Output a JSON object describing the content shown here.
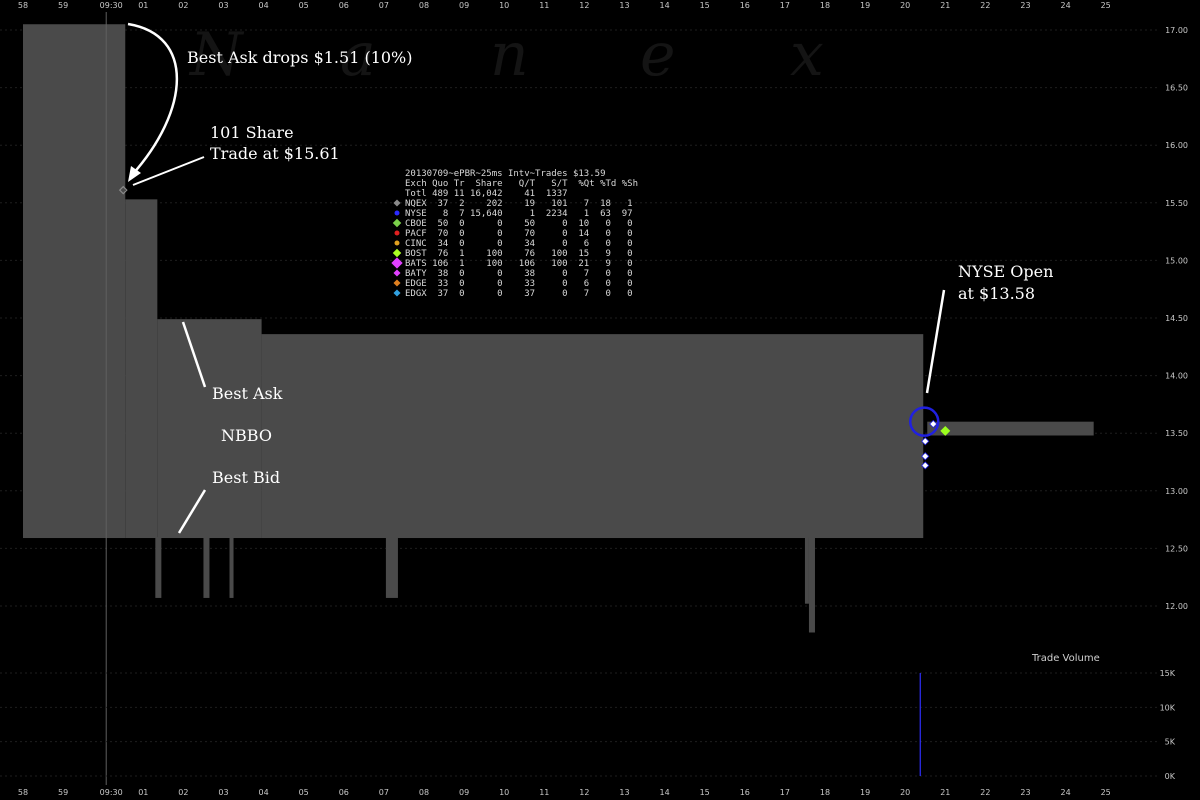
{
  "chart_data": {
    "type": "area",
    "title": "20130709~ePBR~25ms Intv~Trades $13.59",
    "watermark": [
      "N",
      "a",
      "n",
      "e",
      "x"
    ],
    "x_ticks": [
      "58",
      "59",
      "09:30",
      "01",
      "02",
      "03",
      "04",
      "05",
      "06",
      "07",
      "08",
      "09",
      "10",
      "11",
      "12",
      "13",
      "14",
      "15",
      "16",
      "17",
      "18",
      "19",
      "20",
      "21",
      "22",
      "23",
      "24",
      "25"
    ],
    "x_marker_label": "09:30",
    "y_ticks": [
      "17.00",
      "16.50",
      "16.00",
      "15.50",
      "15.00",
      "14.50",
      "14.00",
      "13.50",
      "13.00",
      "12.50",
      "12.00"
    ],
    "ylim": [
      11.7,
      17.25
    ],
    "nbbo_color": "#4a4a4a",
    "ask_steps": [
      {
        "t0": 0.0,
        "t1": 2.55,
        "ask": 17.05
      },
      {
        "t0": 2.55,
        "t1": 3.35,
        "ask": 15.53
      },
      {
        "t0": 3.35,
        "t1": 5.95,
        "ask": 14.49
      },
      {
        "t0": 5.95,
        "t1": 22.45,
        "ask": 14.36
      }
    ],
    "bid_level": 12.59,
    "bid_spikes": [
      {
        "t0": 3.3,
        "t1": 3.45,
        "bid": 12.07
      },
      {
        "t0": 4.5,
        "t1": 4.65,
        "bid": 12.07
      },
      {
        "t0": 5.15,
        "t1": 5.25,
        "bid": 12.07
      },
      {
        "t0": 9.05,
        "t1": 9.35,
        "bid": 12.07
      },
      {
        "t0": 19.5,
        "t1": 19.6,
        "bid": 12.02
      },
      {
        "t0": 19.6,
        "t1": 19.75,
        "bid": 11.77
      }
    ],
    "post_open_band": [
      {
        "t0": 22.55,
        "t1": 26.7,
        "ask": 13.6,
        "bid": 13.48
      }
    ],
    "trades": [
      {
        "t": 2.5,
        "price": 15.61,
        "exchange": "NQEX",
        "color": "#8a8a8a"
      },
      {
        "t": 22.7,
        "price": 13.58,
        "exchange": "NYSE",
        "color": "#ffffff"
      },
      {
        "t": 22.5,
        "price": 13.43,
        "exchange": "NYSE",
        "color": "#ffffff"
      },
      {
        "t": 22.5,
        "price": 13.3,
        "exchange": "NYSE",
        "color": "#ffffff"
      },
      {
        "t": 22.5,
        "price": 13.22,
        "exchange": "NYSE",
        "color": "#ffffff"
      },
      {
        "t": 23.0,
        "price": 13.52,
        "exchange": "BOST",
        "color": "#9cff1e"
      }
    ],
    "open_circle": {
      "t": 22.5,
      "price": 13.6,
      "color": "#2020e0"
    },
    "volume": {
      "title": "Trade Volume",
      "y_ticks": [
        "15K",
        "10K",
        "5K",
        "0K"
      ],
      "ylim": [
        0,
        15000
      ],
      "bars": [
        {
          "t": 22.5,
          "value": 15000
        }
      ],
      "color": "#3030ff"
    },
    "annotations": {
      "ask_drop": "Best Ask drops $1.51 (10%)",
      "trade_line1": "101 Share",
      "trade_line2": "Trade at $15.61",
      "best_ask": "Best Ask",
      "nbbo": "NBBO",
      "best_bid": "Best Bid",
      "open_line1": "NYSE Open",
      "open_line2": "at $13.58"
    },
    "table": {
      "header": "Exch Quo Tr  Share   Q/T   S/T  %Qt %Td %Sh",
      "total": "Totl 489 11 16,042    41  1337",
      "rows": [
        {
          "marker_color": "#8a8a8a",
          "marker": "diamond",
          "text": "NQEX  37  2    202    19   101   7  18   1"
        },
        {
          "marker_color": "#2a2aff",
          "marker": "circle",
          "text": "NYSE   8  7 15,640     1  2234   1  63  97"
        },
        {
          "marker_color": "#7ad04a",
          "marker": "square",
          "text": "CBOE  50  0      0    50     0  10   0   0"
        },
        {
          "marker_color": "#e02020",
          "marker": "circle",
          "text": "PACF  70  0      0    70     0  14   0   0"
        },
        {
          "marker_color": "#e0a020",
          "marker": "circle",
          "text": "CINC  34  0      0    34     0   6   0   0"
        },
        {
          "marker_color": "#aaff22",
          "marker": "square",
          "text": "BOST  76  1    100    76   100  15   9   0"
        },
        {
          "marker_color": "#e040ff",
          "marker": "diamond",
          "text": "BATS 106  1    100   106   100  21   9   0"
        },
        {
          "marker_color": "#e040ff",
          "marker": "diamond",
          "text": "BATY  38  0      0    38     0   7   0   0"
        },
        {
          "marker_color": "#e08020",
          "marker": "diamond",
          "text": "EDGE  33  0      0    33     0   6   0   0"
        },
        {
          "marker_color": "#30a0e0",
          "marker": "diamond",
          "text": "EDGX  37  0      0    37     0   7   0   0"
        }
      ]
    }
  }
}
